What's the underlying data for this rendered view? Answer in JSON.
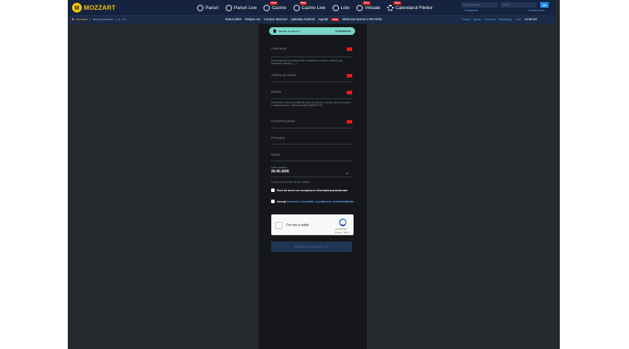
{
  "brand": {
    "mark": "M",
    "name": "MOZZART"
  },
  "nav": [
    {
      "label": "Pariuri",
      "icon": "soccer-ball-icon",
      "badge": ""
    },
    {
      "label": "Pariuri Live",
      "icon": "live-ball-icon",
      "badge": ""
    },
    {
      "label": "Cazino",
      "icon": "casino-chips-icon",
      "badge": "Nou"
    },
    {
      "label": "Cazino Live",
      "icon": "casino-live-icon",
      "badge": "Nou"
    },
    {
      "label": "Loto",
      "icon": "lotto-ball-icon",
      "badge": ""
    },
    {
      "label": "Virtuale",
      "icon": "virtual-icon",
      "badge": "Nou"
    },
    {
      "label": "Calendarul Fibrilor",
      "icon": "gear-icon",
      "badge": "Nou"
    }
  ],
  "login": {
    "username_placeholder": "Nume utilizator",
    "password_placeholder": "Parola",
    "ok_label": "OK",
    "register_label": "Înregistrare",
    "forgot_label": "Ai uitat parola"
  },
  "subbar": {
    "country": "Romania",
    "theme": "Tema întunecată",
    "font_sizes": "A- / A+",
    "links": [
      "Status Bilet",
      "Despre noi",
      "Contact Mozzart",
      "Aplicația Android",
      "Agenții"
    ],
    "promo_badge": "Nou",
    "promo_text": "Welcome Bonus 1750 RON",
    "right_links": [
      "Promo",
      "Ajutor",
      "Francizã",
      "WhatsApp",
      "Chat"
    ],
    "time": "11:58:20"
  },
  "form": {
    "help_text": "Nevoie de ajutor?",
    "help_phone": "0730000000",
    "error_badge": "error",
    "username": {
      "label": "Username"
    },
    "username_hint": "Acesta trebuie sa contina intre 6 caractere cu litere, numere sau caractere speciale (._-)",
    "email": {
      "label": "Adresa de email"
    },
    "password": {
      "label": "Parola"
    },
    "password_hint": "Parola dvs. trebuie să aibă cel puțin 8 caractere, printre care să conțină o majusculă sau o literă specială (@$!%*#?&)",
    "confirm": {
      "label": "Confirmă parola"
    },
    "first_name": {
      "label": "Prenume"
    },
    "last_name": {
      "label": "Nume"
    },
    "dob": {
      "label": "Data nașterii",
      "value": "26-05-2005"
    },
    "age_hint": "Declar că am peste 18 ani împliniți.",
    "promo_check": "Sunt de acord sa receptionez informatii promotionale",
    "terms_prefix": "Accept",
    "terms_link": "termenii & Condițiile și politica de confidențialitate",
    "captcha_label": "I'm not a robot",
    "captcha_brand": "reCAPTCHA",
    "captcha_terms": "Privacy - Terms",
    "submit_label": "ÎNREGISTREAZĂ-TE"
  },
  "colors": {
    "header_bg": "#15233e",
    "page_bg": "#26292e",
    "panel_bg": "#15171a",
    "accent": "#f4c400",
    "help_pill": "#7ad6c8",
    "error": "#e0201e"
  }
}
